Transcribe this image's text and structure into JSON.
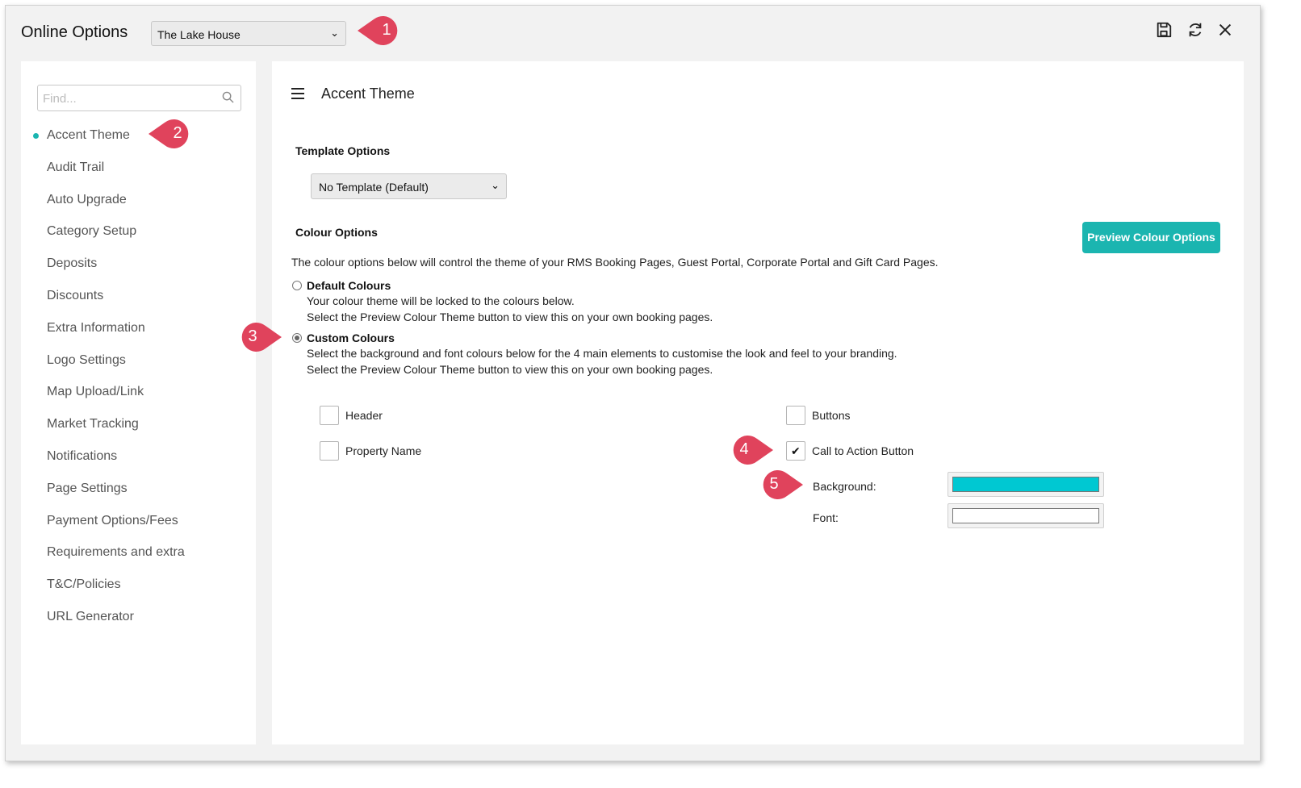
{
  "window": {
    "title": "Online Options",
    "property_select": "The Lake House",
    "toolbar": {
      "save_icon": "save-icon",
      "refresh_icon": "refresh-icon",
      "close_icon": "close-icon"
    }
  },
  "sidebar": {
    "find_placeholder": "Find...",
    "items": [
      {
        "label": "Accent Theme",
        "active": true
      },
      {
        "label": "Audit Trail"
      },
      {
        "label": "Auto Upgrade"
      },
      {
        "label": "Category Setup"
      },
      {
        "label": "Deposits"
      },
      {
        "label": "Discounts"
      },
      {
        "label": "Extra Information"
      },
      {
        "label": "Logo Settings"
      },
      {
        "label": "Map Upload/Link"
      },
      {
        "label": "Market Tracking"
      },
      {
        "label": "Notifications"
      },
      {
        "label": "Page Settings"
      },
      {
        "label": "Payment Options/Fees"
      },
      {
        "label": "Requirements and extra"
      },
      {
        "label": "T&C/Policies"
      },
      {
        "label": "URL Generator"
      }
    ]
  },
  "main": {
    "title": "Accent Theme",
    "template_options_label": "Template Options",
    "template_select": "No Template (Default)",
    "colour_options_label": "Colour Options",
    "preview_button": "Preview Colour Options",
    "description": "The colour options below will control the theme of your RMS Booking Pages, Guest Portal, Corporate Portal and Gift Card Pages.",
    "default_colours": {
      "title": "Default Colours",
      "checked": false,
      "line1": "Your colour theme will be locked to the colours below.",
      "line2": "Select the Preview Colour Theme button to view this on your own booking pages."
    },
    "custom_colours": {
      "title": "Custom Colours",
      "checked": true,
      "line1": "Select the background and font colours below for the 4 main elements to customise the look and feel to your branding.",
      "line2": "Select the Preview Colour Theme button to view this on your own booking pages."
    },
    "elements": {
      "header": {
        "label": "Header",
        "checked": false
      },
      "property_name": {
        "label": "Property Name",
        "checked": false
      },
      "buttons": {
        "label": "Buttons",
        "checked": false
      },
      "call_to_action": {
        "label": "Call to Action Button",
        "checked": true
      }
    },
    "cta_colours": {
      "background_label": "Background:",
      "background_colour": "#00c8d2",
      "font_label": "Font:",
      "font_colour": "#ffffff"
    }
  },
  "callouts": [
    "1",
    "2",
    "3",
    "4",
    "5"
  ],
  "colors": {
    "accent": "#1bb5b0",
    "callout": "#e0435c"
  }
}
